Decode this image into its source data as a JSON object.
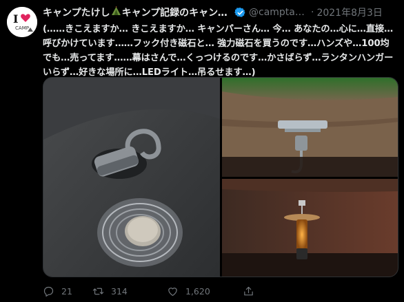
{
  "user": {
    "avatar_label": "CAMP",
    "name_prefix": "キャンプたけし",
    "name_suffix": "キャンプ記録のキャンプ道具",
    "name_emoji": "tent-emoji",
    "handle": "@camptakeshi",
    "separator": "·",
    "date": "2021年8月3日",
    "verified_icon": "verified-badge-icon"
  },
  "tweet": {
    "text": "(……きこえますか… きこえますか… キャンパーさん… 今… あなたの…心に…直接…呼びかけています……フック付き磁石と… 強力磁石を買うのです…ハンズや…100均でも…売ってます……幕はさんで…くっつけるのです…かさばらず…ランタンハンガーいらず…好きな場所に…LEDライト…吊るせます…)"
  },
  "media": {
    "images": [
      {
        "name": "hook-magnet-photo"
      },
      {
        "name": "tarp-magnet-hook-photo"
      },
      {
        "name": "hanging-led-lantern-photo"
      }
    ]
  },
  "actions": {
    "reply_count": "21",
    "retweet_count": "314",
    "like_count": "1,620",
    "icons": [
      "reply-icon",
      "retweet-icon",
      "like-icon",
      "share-icon"
    ]
  },
  "colors": {
    "background": "#000000",
    "text": "#e7e9ea",
    "muted": "#71767b",
    "verified": "#1d9bf0"
  }
}
